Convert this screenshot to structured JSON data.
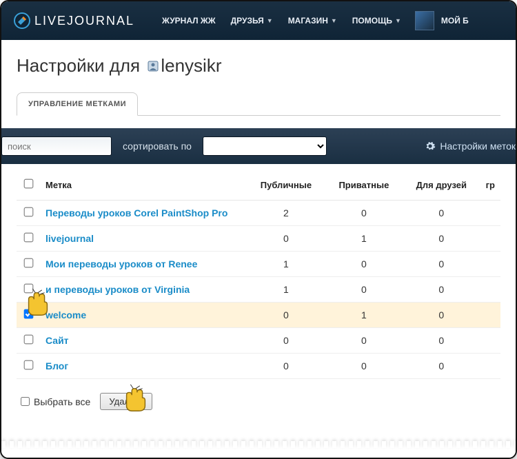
{
  "brand": "LIVEJOURNAL",
  "nav": {
    "items": [
      "ЖУРНАЛ ЖЖ",
      "ДРУЗЬЯ",
      "МАГАЗИН",
      "ПОМОЩЬ"
    ],
    "user": "МОЙ Б"
  },
  "page": {
    "title_prefix": "Настройки для ",
    "username": "lenysikr"
  },
  "tabs": {
    "active": "УПРАВЛЕНИЕ МЕТКАМИ"
  },
  "toolbar": {
    "search_placeholder": "поиск",
    "sort_label": "сортировать по",
    "settings_link": "Настройки меток"
  },
  "table": {
    "headers": {
      "tag": "Метка",
      "public": "Публичные",
      "private": "Приватные",
      "friends": "Для друзей",
      "group": "гр"
    },
    "rows": [
      {
        "checked": false,
        "tag": "Переводы уроков Corel PaintShop Pro",
        "public": 2,
        "private": 0,
        "friends": 0
      },
      {
        "checked": false,
        "tag": "livejournal",
        "public": 0,
        "private": 1,
        "friends": 0
      },
      {
        "checked": false,
        "tag": "Мои переводы уроков от Renee",
        "public": 1,
        "private": 0,
        "friends": 0
      },
      {
        "checked": false,
        "tag": "и переводы уроков от Virginia",
        "public": 1,
        "private": 0,
        "friends": 0
      },
      {
        "checked": true,
        "tag": "welcome",
        "public": 0,
        "private": 1,
        "friends": 0
      },
      {
        "checked": false,
        "tag": "Сайт",
        "public": 0,
        "private": 0,
        "friends": 0
      },
      {
        "checked": false,
        "tag": "Блог",
        "public": 0,
        "private": 0,
        "friends": 0
      }
    ]
  },
  "footer": {
    "select_all": "Выбрать все",
    "delete": "Удалить"
  }
}
